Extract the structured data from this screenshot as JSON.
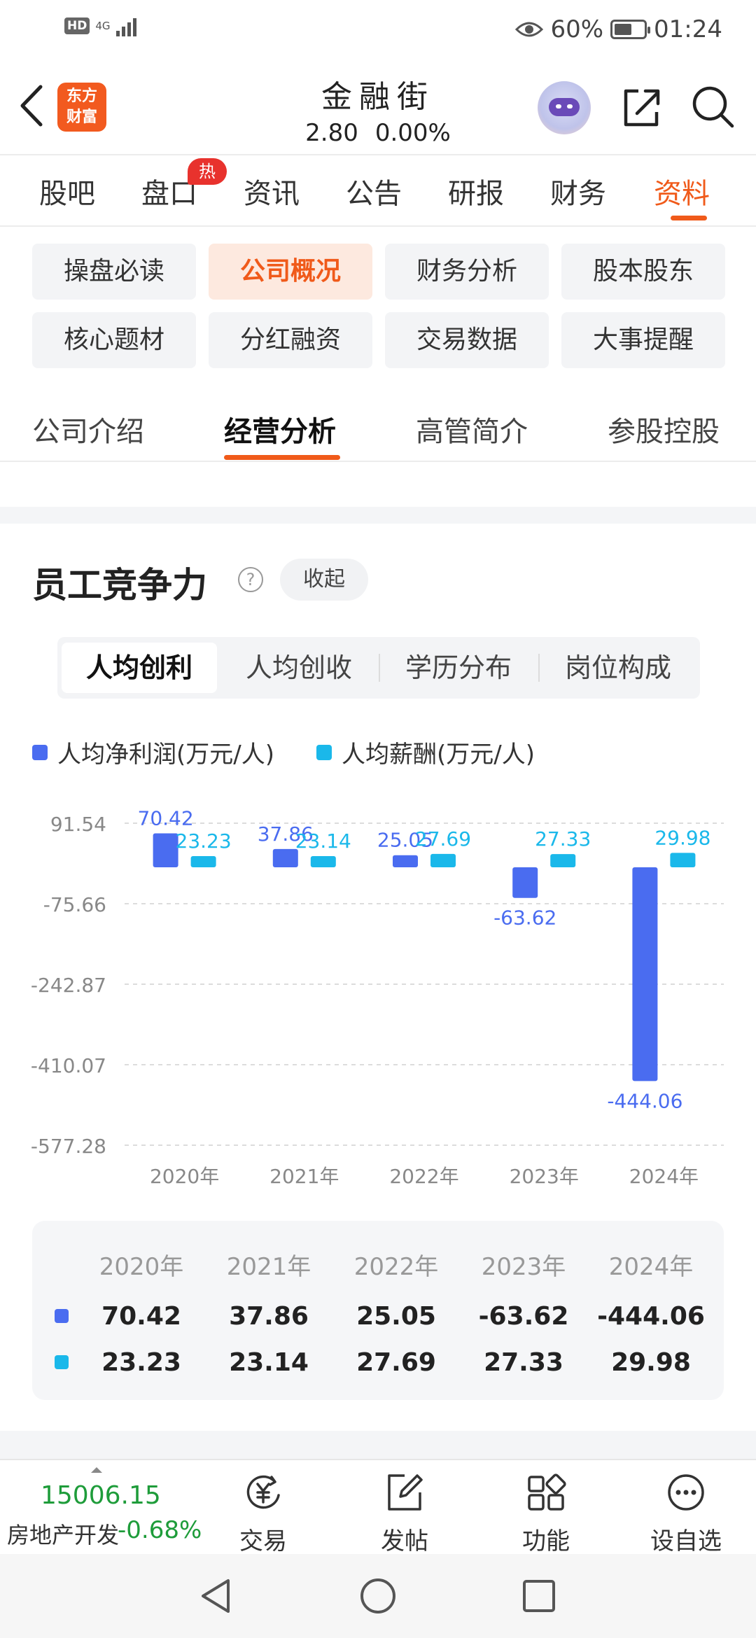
{
  "status_bar": {
    "hd": "HD",
    "network": "4G",
    "battery_percent": "60%",
    "battery_level": 0.6,
    "time": "01:24"
  },
  "header": {
    "logo_text_1": "东方",
    "logo_text_2": "财富",
    "title": "金融街",
    "price": "2.80",
    "change": "0.00%"
  },
  "main_tabs": [
    "股吧",
    "盘口",
    "资讯",
    "公告",
    "研报",
    "财务",
    "资料"
  ],
  "main_tabs_active": "资料",
  "hot_badge": "热",
  "chips": [
    "操盘必读",
    "公司概况",
    "财务分析",
    "股本股东",
    "核心题材",
    "分红融资",
    "交易数据",
    "大事提醒"
  ],
  "chips_active": "公司概况",
  "sub_tabs": [
    "公司介绍",
    "经营分析",
    "高管简介",
    "参股控股"
  ],
  "sub_tabs_active": "经营分析",
  "section": {
    "title": "员工竞争力",
    "help": "?",
    "collapse_label": "收起"
  },
  "segments": [
    "人均创利",
    "人均创收",
    "学历分布",
    "岗位构成"
  ],
  "segments_active": "人均创利",
  "colors": {
    "accent": "#f05a1a",
    "series_net_profit": "#4a6cf0",
    "series_salary": "#1ab8ea",
    "index_green": "#1e9c3a"
  },
  "chart_data": {
    "type": "bar",
    "categories": [
      "2020年",
      "2021年",
      "2022年",
      "2023年",
      "2024年"
    ],
    "series": [
      {
        "name": "人均净利润(万元/人)",
        "values": [
          70.42,
          37.86,
          25.05,
          -63.62,
          -444.06
        ]
      },
      {
        "name": "人均薪酬(万元/人)",
        "values": [
          23.23,
          23.14,
          27.69,
          27.33,
          29.98
        ]
      }
    ],
    "yticks": [
      "91.54",
      "-75.66",
      "-242.87",
      "-410.07",
      "-577.28"
    ],
    "ylim": [
      -577.28,
      91.54
    ],
    "grid": true,
    "legend": "top-left",
    "data_labels": true
  },
  "table": {
    "headers": [
      "2020年",
      "2021年",
      "2022年",
      "2023年",
      "2024年"
    ],
    "rows": [
      [
        "70.42",
        "37.86",
        "25.05",
        "-63.62",
        "-444.06"
      ],
      [
        "23.23",
        "23.14",
        "27.69",
        "27.33",
        "29.98"
      ]
    ]
  },
  "bottom_bar": {
    "index_value": "15006.15",
    "index_name": "房地产开发",
    "index_change": "-0.68%",
    "items": [
      {
        "label": "交易",
        "icon": "trade-yen-icon"
      },
      {
        "label": "发帖",
        "icon": "compose-icon"
      },
      {
        "label": "功能",
        "icon": "grid-apps-icon"
      },
      {
        "label": "设自选",
        "icon": "more-dots-icon"
      }
    ]
  }
}
